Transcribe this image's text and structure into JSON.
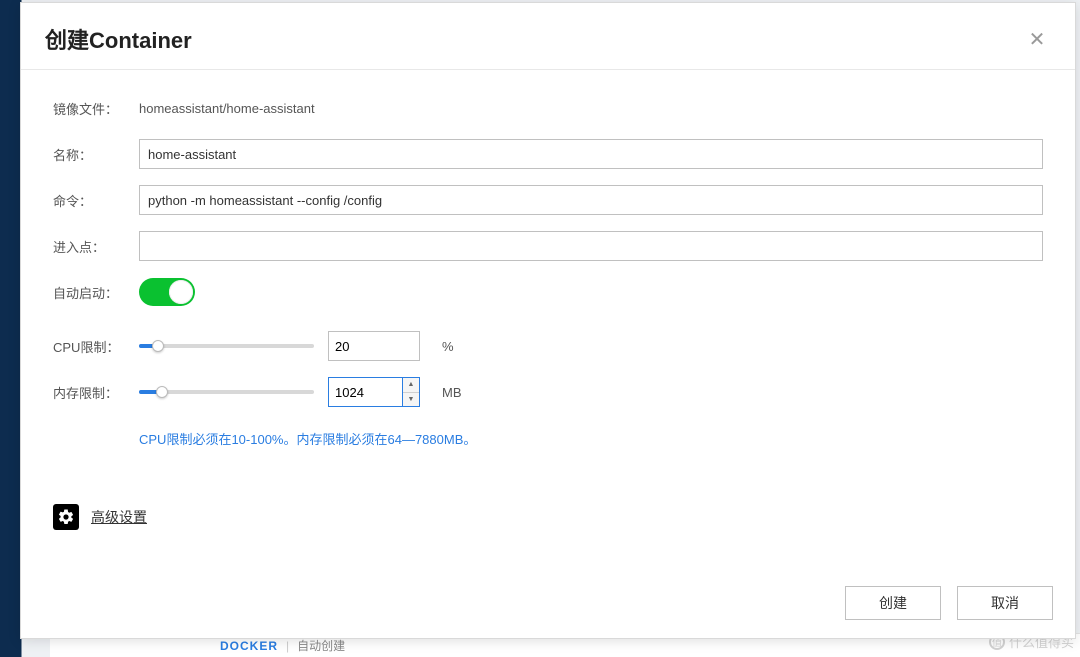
{
  "modal": {
    "title": "创建Container",
    "close_aria": "close"
  },
  "form": {
    "image_label": "镜像文件：",
    "image_value": "homeassistant/home-assistant",
    "name_label": "名称：",
    "name_value": "home-assistant",
    "command_label": "命令：",
    "command_value": "python -m homeassistant --config /config",
    "entrypoint_label": "进入点：",
    "entrypoint_value": "",
    "autostart_label": "自动启动：",
    "autostart_on": true,
    "cpu_label": "CPU限制：",
    "cpu_value": "20",
    "cpu_unit": "%",
    "cpu_slider_percent": 11,
    "mem_label": "内存限制：",
    "mem_value": "1024",
    "mem_unit": "MB",
    "mem_slider_percent": 13,
    "hint": "CPU限制必须在10-100%。内存限制必须在64—7880MB。",
    "advanced_label": "高级设置"
  },
  "footer": {
    "create": "创建",
    "cancel": "取消"
  },
  "behind": {
    "text1": "DOCKER",
    "text2": "自动创建"
  },
  "watermark": "什么值得买"
}
